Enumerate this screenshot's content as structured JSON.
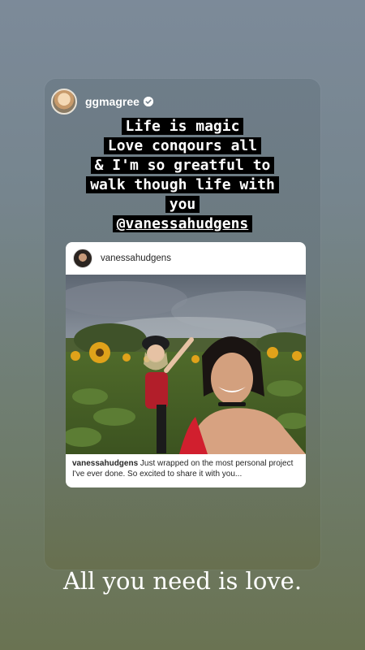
{
  "story": {
    "reshared_by": {
      "username": "ggmagree",
      "verified": true
    },
    "caption_lines": [
      "Life is magic",
      "Love conqours all",
      "& I'm so greatful to",
      "walk though life with",
      "you",
      "@vanessahudgens"
    ],
    "post": {
      "username": "vanessahudgens",
      "caption_user": "vanessahudgens",
      "caption_text": " Just wrapped on the most personal project I've ever done. So excited to share it with you..."
    },
    "bottom_text": "All you need is love."
  },
  "colors": {
    "caption_bg": "#000000",
    "caption_fg": "#ffffff",
    "badge": "#3897f0"
  },
  "icons": [
    "verified-icon"
  ]
}
